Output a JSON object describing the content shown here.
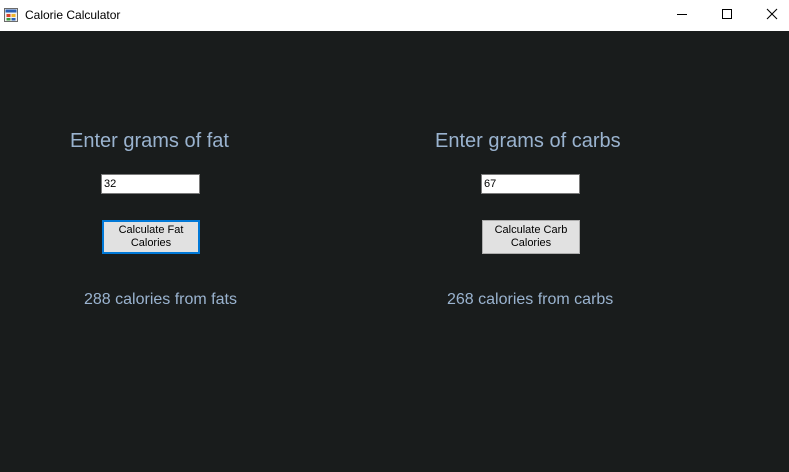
{
  "window": {
    "title": "Calorie Calculator",
    "app_icon": "app-window-icon",
    "controls": {
      "minimize_icon": "minimize-icon",
      "maximize_icon": "maximize-icon",
      "close_icon": "close-icon"
    }
  },
  "fat": {
    "heading": "Enter grams of fat",
    "input_value": "32",
    "button_line1": "Calculate Fat",
    "button_line2": "Calories",
    "result": "288 calories from fats"
  },
  "carbs": {
    "heading": "Enter grams of carbs",
    "input_value": "67",
    "button_line1": "Calculate Carb",
    "button_line2": "Calories",
    "result": "268 calories from carbs"
  },
  "colors": {
    "background": "#191c1c",
    "label_text": "#9ab3cf",
    "focus_border": "#0078d7"
  }
}
